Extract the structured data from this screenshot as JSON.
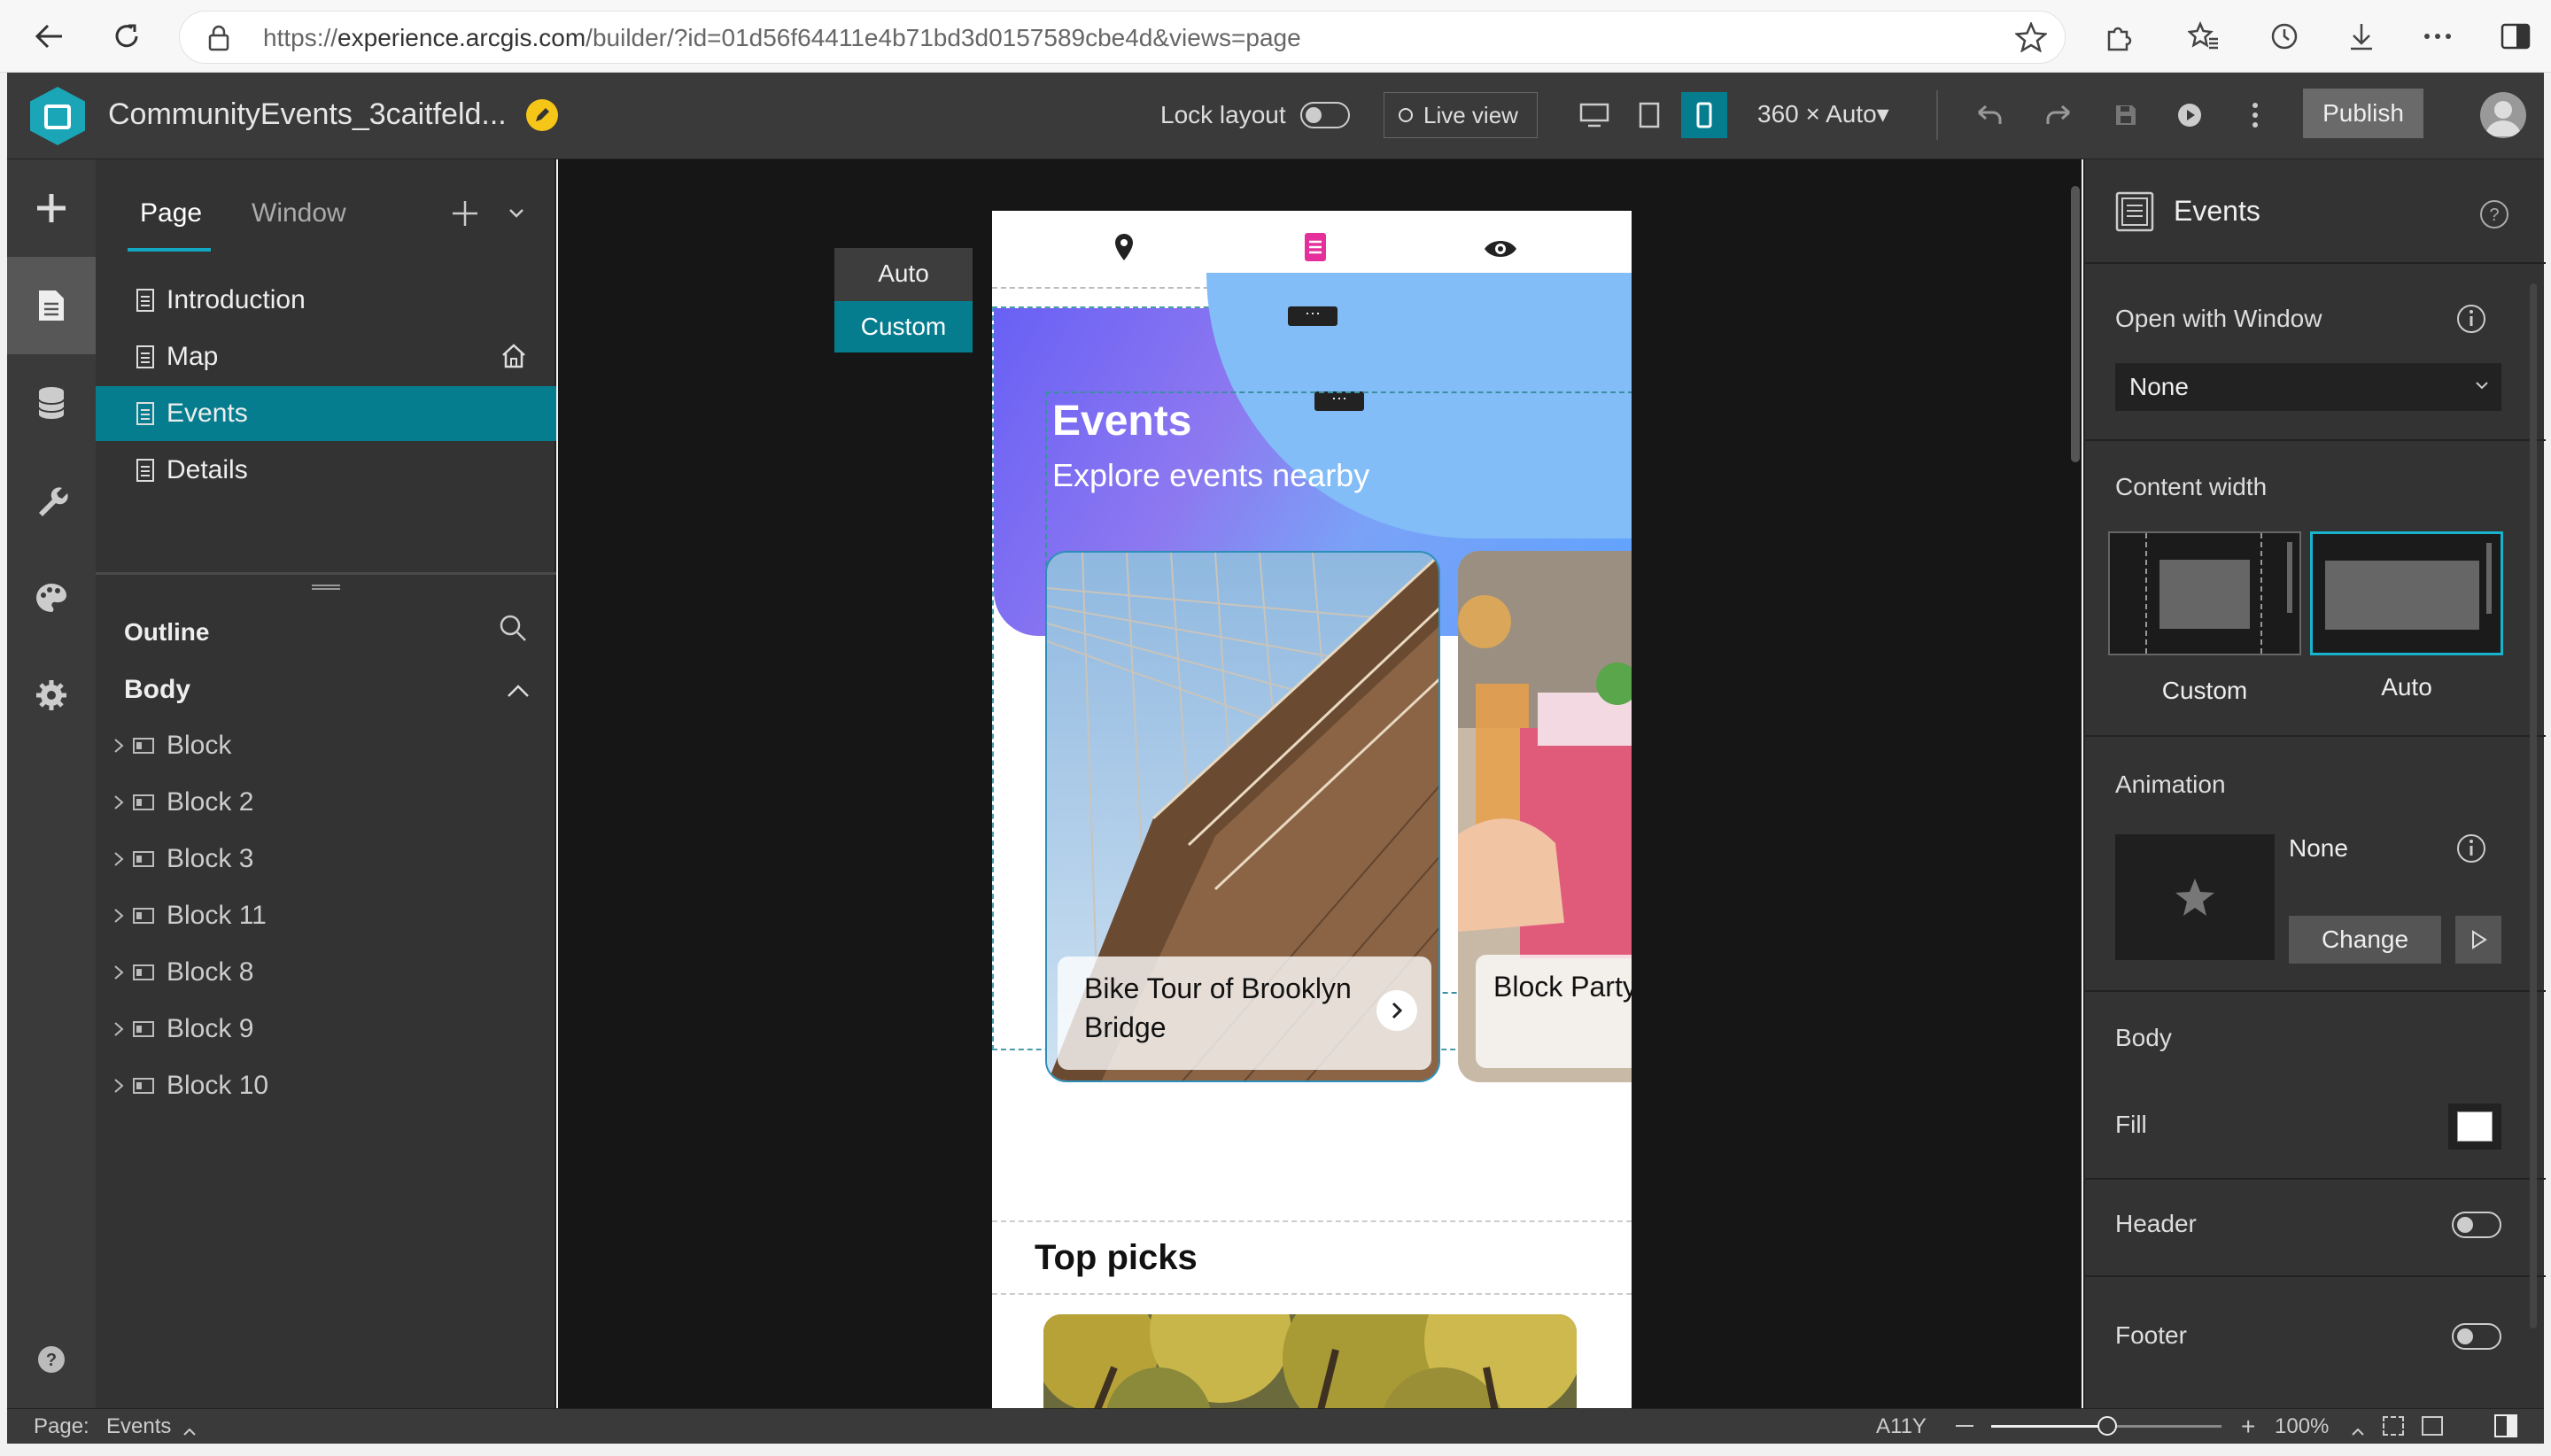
{
  "browser": {
    "url_prefix": "https://",
    "url_host": "experience.arcgis.com",
    "url_path": "/builder/?id=01d56f64411e4b71bd3d0157589cbe4d&views=page"
  },
  "header": {
    "app_title": "CommunityEvents_3caitfeld...",
    "lock_layout_label": "Lock layout",
    "live_view_label": "Live view",
    "size_label": "360 × Auto▾",
    "publish_label": "Publish"
  },
  "pages_panel": {
    "tabs": [
      "Page",
      "Window"
    ],
    "pages": [
      {
        "label": "Introduction"
      },
      {
        "label": "Map"
      },
      {
        "label": "Events"
      },
      {
        "label": "Details"
      }
    ],
    "outline_label": "Outline",
    "body_label": "Body",
    "blocks": [
      "Block",
      "Block 2",
      "Block 3",
      "Block 11",
      "Block 8",
      "Block 9",
      "Block 10"
    ]
  },
  "canvas": {
    "size_options": [
      "Auto",
      "Custom"
    ],
    "hero_title": "Events",
    "hero_subtitle": "Explore events nearby",
    "card1_label": "Bike Tour of Brooklyn Bridge",
    "card2_label": "Block Party",
    "section_title": "Top picks"
  },
  "right_panel": {
    "title": "Events",
    "open_with_window_label": "Open with Window",
    "open_with_window_value": "None",
    "content_width_label": "Content width",
    "content_width_options": [
      "Custom",
      "Auto"
    ],
    "animation_label": "Animation",
    "animation_value": "None",
    "change_label": "Change",
    "body_label": "Body",
    "fill_label": "Fill",
    "header_label": "Header",
    "footer_label": "Footer"
  },
  "status_bar": {
    "page_prefix": "Page:",
    "page_name": "Events",
    "a11y_label": "A11Y",
    "zoom": "100%"
  },
  "colors": {
    "accent": "#067d8f",
    "panel": "#333333",
    "canvas": "#161616"
  }
}
